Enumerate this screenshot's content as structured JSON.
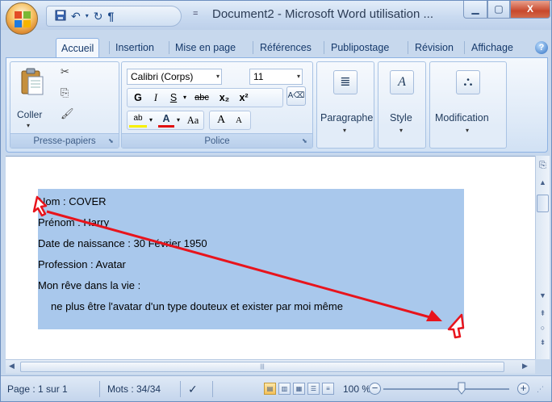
{
  "window": {
    "title": "Document2 - Microsoft Word utilisation ...",
    "controls": {
      "minimize": "▁",
      "maximize": "▢",
      "close": "X"
    }
  },
  "qat": {
    "more": "="
  },
  "tabs": [
    {
      "label": "Accueil",
      "active": true
    },
    {
      "label": "Insertion"
    },
    {
      "label": "Mise en page"
    },
    {
      "label": "Références"
    },
    {
      "label": "Publipostage"
    },
    {
      "label": "Révision"
    },
    {
      "label": "Affichage"
    }
  ],
  "ribbon": {
    "clipboard": {
      "group_label": "Presse-papiers",
      "paste_label": "Coller"
    },
    "font": {
      "group_label": "Police",
      "font_name": "Calibri (Corps)",
      "font_size": "11",
      "bold": "G",
      "italic": "I",
      "underline": "S",
      "strike": "abc",
      "subscript": "x₂",
      "superscript": "x²",
      "highlight": "ab",
      "font_color": "A",
      "case": "Aa",
      "grow": "A",
      "shrink": "A"
    },
    "paragraph": {
      "label": "Paragraphe"
    },
    "style": {
      "label": "Style"
    },
    "editing": {
      "label": "Modification"
    }
  },
  "document": {
    "lines": [
      "Nom : COVER",
      "Prénom : Harry",
      "Date de naissance : 30 Février 1950",
      "Profession : Avatar",
      "Mon rêve dans la vie :",
      "ne plus être l'avatar d'un type douteux et exister par moi même"
    ],
    "selection_color": "#a9c8ec",
    "annotation_color": "#e8141c"
  },
  "statusbar": {
    "page": "Page : 1 sur 1",
    "words": "Mots : 34/34",
    "zoom": "100 %",
    "zoom_level_percent": 100
  }
}
